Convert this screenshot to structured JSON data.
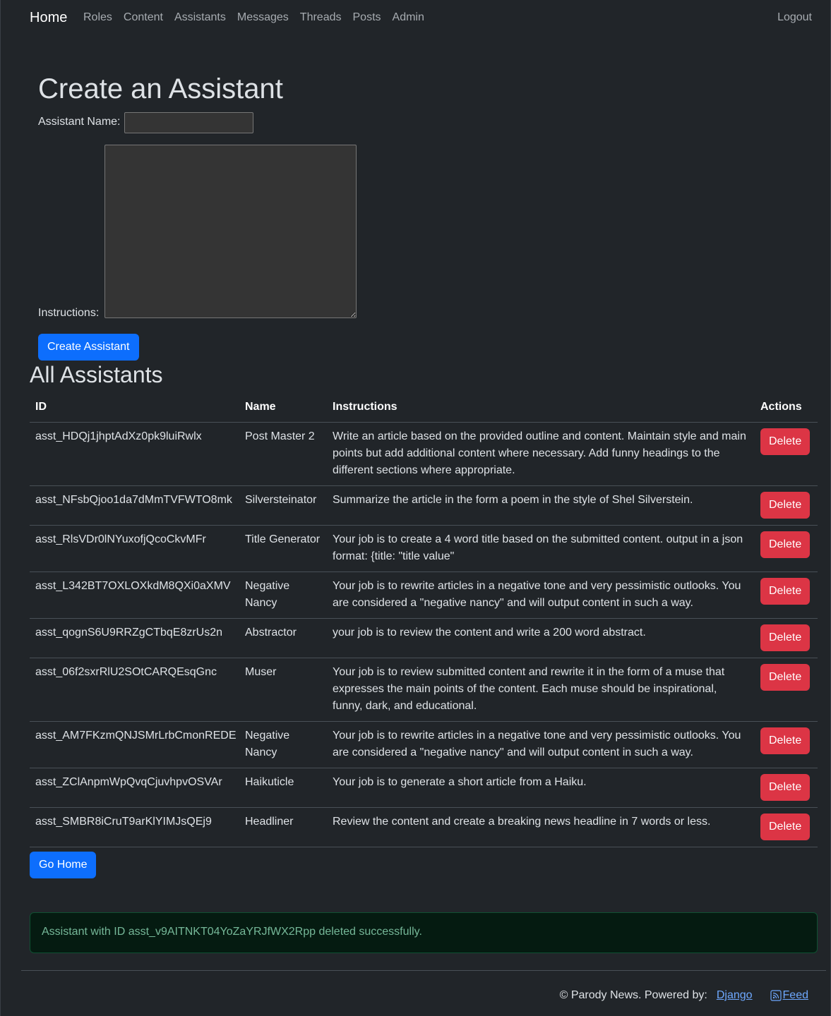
{
  "navbar": {
    "brand": "Home",
    "links": [
      "Roles",
      "Content",
      "Assistants",
      "Messages",
      "Threads",
      "Posts",
      "Admin"
    ],
    "logout": "Logout"
  },
  "create_form": {
    "title": "Create an Assistant",
    "name_label": "Assistant Name:",
    "name_value": "",
    "instructions_label": "Instructions:",
    "instructions_value": "",
    "submit_label": "Create Assistant"
  },
  "assistants": {
    "title": "All Assistants",
    "columns": [
      "ID",
      "Name",
      "Instructions",
      "Actions"
    ],
    "delete_label": "Delete",
    "rows": [
      {
        "id": "asst_HDQj1jhptAdXz0pk9luiRwlx",
        "name": "Post Master 2",
        "instructions": "Write an article based on the provided outline and content. Maintain style and main points but add additional content where necessary. Add funny headings to the different sections where appropriate."
      },
      {
        "id": "asst_NFsbQjoo1da7dMmTVFWTO8mk",
        "name": "Silversteinator",
        "instructions": "Summarize the article in the form a poem in the style of Shel Silverstein."
      },
      {
        "id": "asst_RlsVDr0lNYuxofjQcoCkvMFr",
        "name": "Title Generator",
        "instructions": "Your job is to create a 4 word title based on the submitted content. output in a json format: {title: \"title value\""
      },
      {
        "id": "asst_L342BT7OXLOXkdM8QXi0aXMV",
        "name": "Negative Nancy",
        "instructions": "Your job is to rewrite articles in a negative tone and very pessimistic outlooks. You are considered a \"negative nancy\" and will output content in such a way."
      },
      {
        "id": "asst_qognS6U9RRZgCTbqE8zrUs2n",
        "name": "Abstractor",
        "instructions": "your job is to review the content and write a 200 word abstract."
      },
      {
        "id": "asst_06f2sxrRlU2SOtCARQEsqGnc",
        "name": "Muser",
        "instructions": "Your job is to review submitted content and rewrite it in the form of a muse that expresses the main points of the content. Each muse should be inspirational, funny, dark, and educational."
      },
      {
        "id": "asst_AM7FKzmQNJSMrLrbCmonREDE",
        "name": "Negative Nancy",
        "instructions": "Your job is to rewrite articles in a negative tone and very pessimistic outlooks. You are considered a \"negative nancy\" and will output content in such a way."
      },
      {
        "id": "asst_ZClAnpmWpQvqCjuvhpvOSVAr",
        "name": "Haikuticle",
        "instructions": "Your job is to generate a short article from a Haiku."
      },
      {
        "id": "asst_SMBR8iCruT9arKlYIMJsQEj9",
        "name": "Headliner",
        "instructions": "Review the content and create a breaking news headline in 7 words or less."
      }
    ]
  },
  "go_home_label": "Go Home",
  "alert": {
    "message": "Assistant with ID asst_v9AITNKT04YoZaYRJfWX2Rpp deleted successfully.",
    "color": "#75b798"
  },
  "footer": {
    "text": "© Parody News. Powered by:",
    "django_link": "Django",
    "feed_link": "Feed",
    "feed_icon": "rss-icon"
  },
  "colors": {
    "background": "#212529",
    "primary": "#0d6efd",
    "danger": "#dc3545",
    "link": "#6ea8fe"
  }
}
